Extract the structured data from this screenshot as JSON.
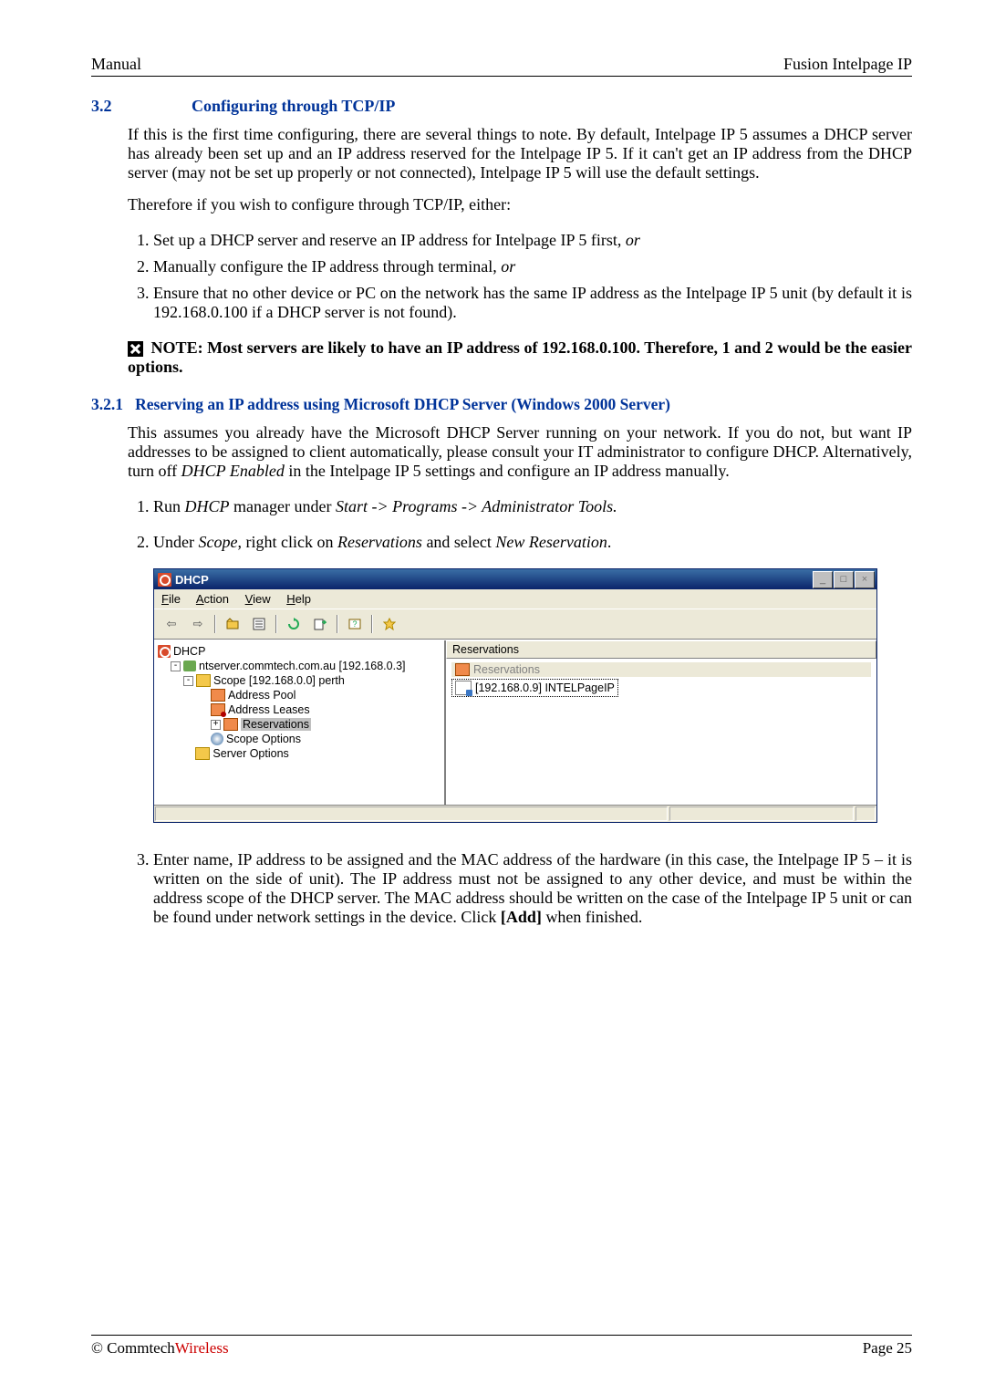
{
  "header": {
    "left": "Manual",
    "right": "Fusion Intelpage IP"
  },
  "sec32": {
    "num": "3.2",
    "title": "Configuring through TCP/IP",
    "p1": "If this is the first time configuring, there are several things to note. By default, Intelpage IP 5 assumes a DHCP server has already been set up and an IP address reserved for the Intelpage IP 5. If it can't get an IP address from the DHCP server (may not be set up properly or not connected), Intelpage IP 5 will use the default settings.",
    "p2": "Therefore if you wish to configure through TCP/IP, either:",
    "li1a": "Set up a DHCP server and reserve an IP address for Intelpage IP 5 first, ",
    "li1b": "or",
    "li2a": "Manually configure the IP address through terminal, ",
    "li2b": "or",
    "li3": "Ensure that no other device or PC on the network has the same IP address as the Intelpage IP 5 unit (by default it is 192.168.0.100 if a DHCP server is not found).",
    "note": " NOTE: Most servers are likely to have an IP address of 192.168.0.100. Therefore, 1 and 2 would be the easier options."
  },
  "sec321": {
    "num": "3.2.1",
    "title": "Reserving an IP address using Microsoft DHCP Server (Windows 2000 Server)",
    "p1": "This assumes you already have the Microsoft DHCP Server running on your network. If you do not, but want IP addresses to be assigned to client automatically, please consult your IT administrator to configure DHCP. Alternatively, turn off ",
    "p1i": "DHCP Enabled",
    "p1b": " in the Intelpage IP 5 settings and configure an IP address manually.",
    "step1a": "Run ",
    "step1b": "DHCP",
    "step1c": " manager under ",
    "step1d": "Start -> Programs -> Administrator Tools.",
    "step2a": "Under ",
    "step2b": "Scope",
    "step2c": ", right click on ",
    "step2d": "Reservations",
    "step2e": " and select ",
    "step2f": "New Reservation",
    "step2g": ".",
    "step3a": "Enter name, IP address to be assigned and the MAC address of the hardware (in this case, the Intelpage IP 5 – it is written on the side of unit). The IP address must not be assigned to any other device, and must be within the address scope of the DHCP server. The MAC address should be written on the case of the Intelpage IP 5 unit or can be found under network settings in the device. Click ",
    "step3b": "[Add]",
    "step3c": " when finished."
  },
  "dhcp": {
    "title": "DHCP",
    "menu": {
      "file": "File",
      "action": "Action",
      "view": "View",
      "help": "Help"
    },
    "tree": {
      "root": "DHCP",
      "srv": "ntserver.commtech.com.au [192.168.0.3]",
      "scope": "Scope [192.168.0.0] perth",
      "pool": "Address Pool",
      "leases": "Address Leases",
      "res": "Reservations",
      "sopt": "Scope Options",
      "sropt": "Server Options"
    },
    "right": {
      "header": "Reservations",
      "grayrow": "Reservations",
      "row": "[192.168.0.9] INTELPageIP"
    }
  },
  "footer": {
    "left1": "© Commtech",
    "left2": "Wireless",
    "right": "Page 25"
  }
}
